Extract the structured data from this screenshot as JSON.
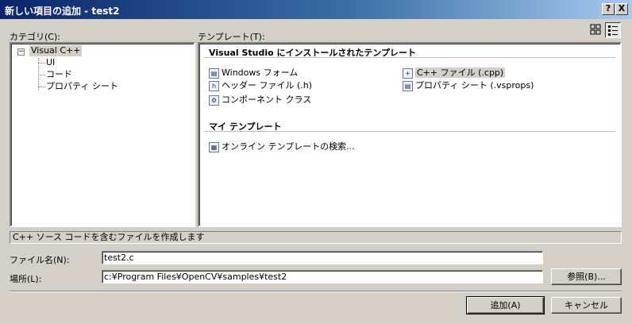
{
  "window": {
    "title": "新しい項目の追加 - test2",
    "help_label": "?",
    "close_label": "X"
  },
  "categories": {
    "label": "カテゴリ(C):",
    "root": "Visual C++",
    "children": [
      "UI",
      "コード",
      "プロパティ シート"
    ]
  },
  "templates": {
    "label": "テンプレート(T):",
    "view_large_icon": "large-icons-view-icon",
    "view_small_icon": "small-icons-view-icon",
    "installed_header": "Visual Studio にインストールされたテンプレート",
    "installed": [
      {
        "label": "Windows フォーム",
        "icon": "form-icon"
      },
      {
        "label": "ヘッダー ファイル (.h)",
        "icon": "header-file-icon"
      },
      {
        "label": "コンポーネント クラス",
        "icon": "component-class-icon"
      },
      {
        "label": "C++ ファイル (.cpp)",
        "icon": "cpp-file-icon",
        "selected": true
      },
      {
        "label": "プロパティ シート (.vsprops)",
        "icon": "property-sheet-icon"
      }
    ],
    "my_header": "マイ テンプレート",
    "my": [
      {
        "label": "オンライン テンプレートの検索...",
        "icon": "online-search-icon"
      }
    ]
  },
  "description": "C++ ソース コードを含むファイルを作成します",
  "form": {
    "name_label": "ファイル名(N):",
    "name_value": "test2.c",
    "location_label": "場所(L):",
    "location_value": "c:¥Program Files¥OpenCV¥samples¥test2",
    "browse_label": "参照(B)..."
  },
  "buttons": {
    "add": "追加(A)",
    "cancel": "キャンセル"
  }
}
